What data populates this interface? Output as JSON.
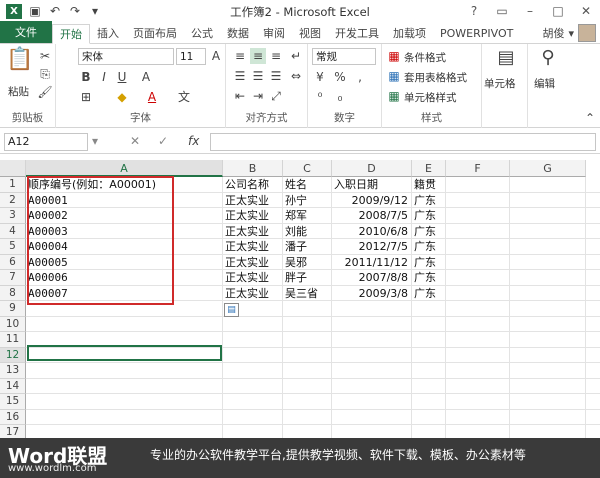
{
  "window": {
    "title": "工作簿2 - Microsoft Excel",
    "app_logo": "X"
  },
  "tabs": {
    "file": "文件",
    "items": [
      "开始",
      "插入",
      "页面布局",
      "公式",
      "数据",
      "审阅",
      "视图",
      "开发工具",
      "加载项",
      "POWERPIVOT"
    ],
    "active": "开始"
  },
  "user": {
    "name": "胡俊"
  },
  "ribbon": {
    "clipboard": {
      "paste": "粘贴",
      "label": "剪贴板"
    },
    "font": {
      "name": "宋体",
      "size": "11",
      "label": "字体"
    },
    "alignment": {
      "label": "对齐方式"
    },
    "number": {
      "format": "常规",
      "label": "数字"
    },
    "styles": {
      "conditional": "条件格式",
      "table": "套用表格格式",
      "cell_styles": "单元格样式",
      "label": "样式"
    },
    "cells": {
      "label": "单元格"
    },
    "editing": {
      "label": "编辑"
    }
  },
  "formula_bar": {
    "name_box": "A12",
    "fx": "fx",
    "value": ""
  },
  "columns": [
    "A",
    "B",
    "C",
    "D",
    "E",
    "F",
    "G"
  ],
  "rows": [
    "1",
    "2",
    "3",
    "4",
    "5",
    "6",
    "7",
    "8",
    "9",
    "10",
    "11",
    "12",
    "13",
    "14",
    "15",
    "16",
    "17"
  ],
  "sheet": {
    "A": [
      "顺序编号(例如：A00001)",
      "A00001",
      "A00002",
      "A00003",
      "A00004",
      "A00005",
      "A00006",
      "A00007"
    ],
    "B": [
      "公司名称",
      "正太实业",
      "正太实业",
      "正太实业",
      "正太实业",
      "正太实业",
      "正太实业",
      "正太实业"
    ],
    "C": [
      "姓名",
      "孙宁",
      "郑军",
      "刘能",
      "潘子",
      "吴邪",
      "胖子",
      "吴三省"
    ],
    "D": [
      "入职日期",
      "2009/9/12",
      "2008/7/5",
      "2010/6/8",
      "2012/7/5",
      "2011/11/12",
      "2007/8/8",
      "2009/3/8"
    ],
    "E": [
      "籍贯",
      "广东",
      "广东",
      "广东",
      "广东",
      "广东",
      "广东",
      "广东"
    ]
  },
  "footer": {
    "brand": "Word联盟",
    "url": "www.wordlm.com",
    "slogan": "专业的办公软件教学平台,提供教学视频、软件下载、模板、办公素材等"
  },
  "colors": {
    "excel_green": "#217346",
    "highlight_red": "#d02a2a"
  }
}
